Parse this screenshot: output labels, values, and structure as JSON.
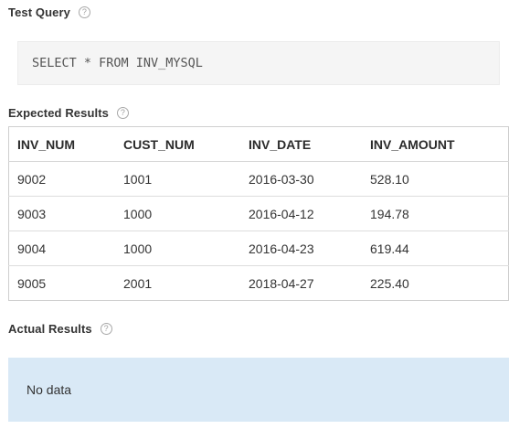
{
  "test_query": {
    "title": "Test Query",
    "help_icon": "question-circle-icon",
    "sql": "SELECT * FROM INV_MYSQL"
  },
  "expected_results": {
    "title": "Expected Results",
    "help_icon": "question-circle-icon",
    "columns": [
      "INV_NUM",
      "CUST_NUM",
      "INV_DATE",
      "INV_AMOUNT"
    ],
    "rows": [
      [
        "9002",
        "1001",
        "2016-03-30",
        "528.10"
      ],
      [
        "9003",
        "1000",
        "2016-04-12",
        "194.78"
      ],
      [
        "9004",
        "1000",
        "2016-04-23",
        "619.44"
      ],
      [
        "9005",
        "2001",
        "2018-04-27",
        "225.40"
      ]
    ]
  },
  "actual_results": {
    "title": "Actual Results",
    "help_icon": "question-circle-icon",
    "empty_message": "No data"
  },
  "colors": {
    "no_data_background": "#d9e9f6",
    "query_background": "#f5f5f5",
    "table_border": "#cfcfcf"
  }
}
